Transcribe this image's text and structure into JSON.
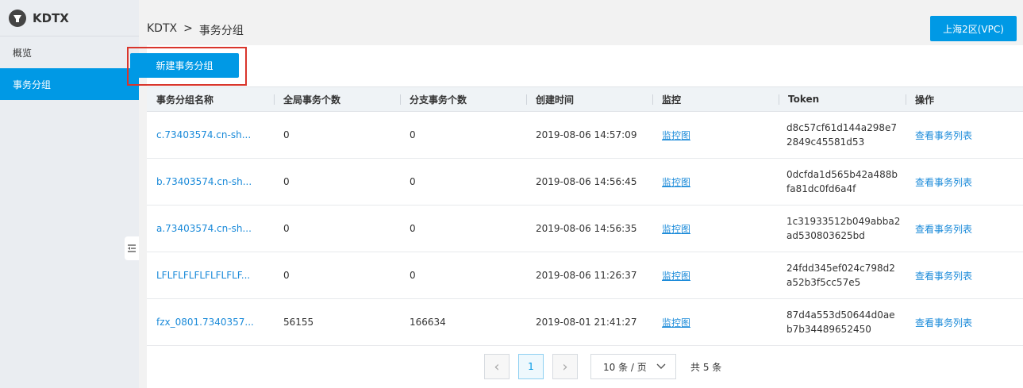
{
  "brand": {
    "title": "KDTX"
  },
  "sidebar": {
    "items": [
      {
        "label": "概览"
      },
      {
        "label": "事务分组"
      }
    ]
  },
  "breadcrumb": {
    "root": "KDTX",
    "separator": ">",
    "current": "事务分组"
  },
  "region": {
    "label": "上海2区(VPC)"
  },
  "toolbar": {
    "create_label": "新建事务分组"
  },
  "table": {
    "headers": [
      "事务分组名称",
      "全局事务个数",
      "分支事务个数",
      "创建时间",
      "监控",
      "Token",
      "操作"
    ],
    "rows": [
      {
        "name": "c.73403574.cn-sh...",
        "global": "0",
        "branch": "0",
        "created": "2019-08-06 14:57:09",
        "monitor": "监控图",
        "token": "d8c57cf61d144a298e72849c45581d53",
        "action": "查看事务列表"
      },
      {
        "name": "b.73403574.cn-sh...",
        "global": "0",
        "branch": "0",
        "created": "2019-08-06 14:56:45",
        "monitor": "监控图",
        "token": "0dcfda1d565b42a488bfa81dc0fd6a4f",
        "action": "查看事务列表"
      },
      {
        "name": "a.73403574.cn-sh...",
        "global": "0",
        "branch": "0",
        "created": "2019-08-06 14:56:35",
        "monitor": "监控图",
        "token": "1c31933512b049abba2ad530803625bd",
        "action": "查看事务列表"
      },
      {
        "name": "LFLFLFLFLFLFLFLF...",
        "global": "0",
        "branch": "0",
        "created": "2019-08-06 11:26:37",
        "monitor": "监控图",
        "token": "24fdd345ef024c798d2a52b3f5cc57e5",
        "action": "查看事务列表"
      },
      {
        "name": "fzx_0801.7340357...",
        "global": "56155",
        "branch": "166634",
        "created": "2019-08-01 21:41:27",
        "monitor": "监控图",
        "token": "87d4a553d50644d0aeb7b34489652450",
        "action": "查看事务列表"
      }
    ]
  },
  "pagination": {
    "prev": "‹",
    "current_page": "1",
    "next": "›",
    "page_size": "10 条 / 页",
    "total": "共 5 条"
  },
  "colors": {
    "primary": "#0099e5",
    "link": "#1a8ad9",
    "highlight_border": "#d9352b"
  }
}
